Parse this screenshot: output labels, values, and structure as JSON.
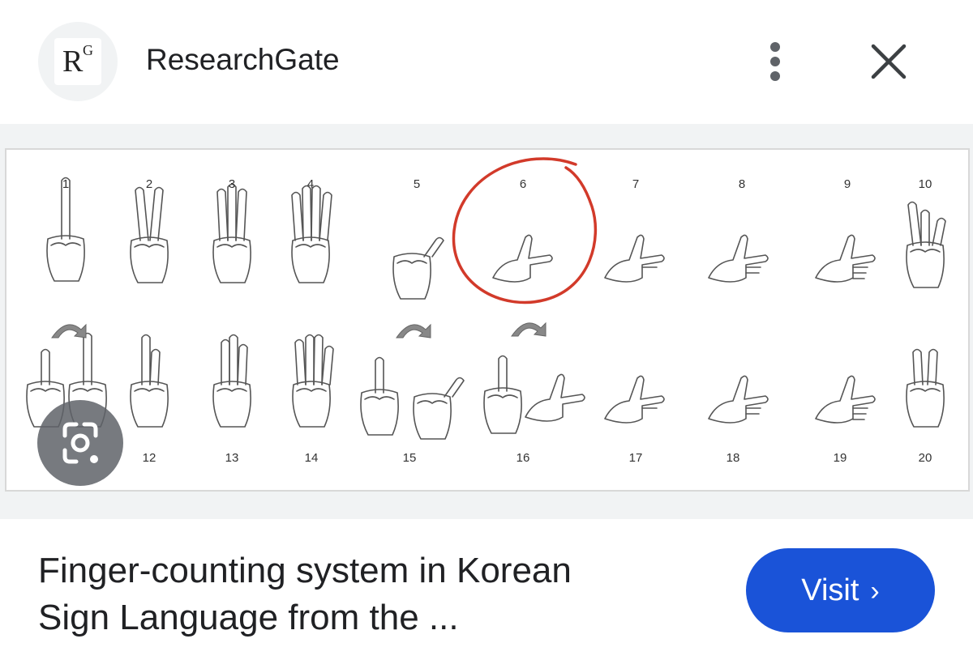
{
  "header": {
    "logo": {
      "letter_main": "R",
      "letter_sup": "G"
    },
    "site_name": "ResearchGate",
    "more_icon": "three-dots-vertical-icon",
    "close_icon": "close-x-icon"
  },
  "image": {
    "top_row_numbers": [
      "1",
      "2",
      "3",
      "4",
      "5",
      "6",
      "7",
      "8",
      "9",
      "10"
    ],
    "bottom_row_numbers": [
      "12",
      "13",
      "14",
      "15",
      "16",
      "17",
      "18",
      "19",
      "20"
    ],
    "highlight_color": "#d23a2a",
    "lens_icon": "google-lens-icon"
  },
  "caption": {
    "line1": "Finger-counting system in Korean",
    "line2": "Sign Language from the ..."
  },
  "visit": {
    "label": "Visit",
    "chevron": "›",
    "color": "#1a53d8"
  }
}
